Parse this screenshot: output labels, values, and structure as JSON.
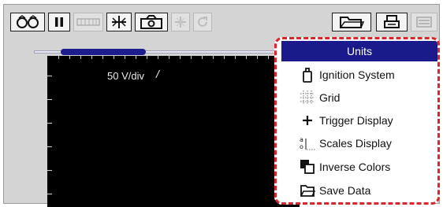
{
  "toolbar": {
    "left_buttons": [
      {
        "icon": "link-icon",
        "state": "enabled"
      },
      {
        "icon": "pause-icon",
        "state": "enabled"
      },
      {
        "icon": "memory-bar-icon",
        "state": "disabled"
      },
      {
        "icon": "cursor-cross-icon",
        "state": "enabled"
      },
      {
        "icon": "camera-icon",
        "state": "enabled"
      },
      {
        "icon": "zoom-icon",
        "state": "disabled"
      },
      {
        "icon": "refresh-icon",
        "state": "disabled"
      }
    ],
    "right_buttons": [
      {
        "icon": "open-folder-icon",
        "state": "enabled"
      },
      {
        "icon": "print-icon",
        "state": "enabled"
      },
      {
        "icon": "menu-icon",
        "state": "selected"
      }
    ]
  },
  "scope": {
    "scale_label": "50 V/div",
    "trigger_symbol": "/"
  },
  "menu": {
    "items": [
      {
        "label": "Units",
        "icon": "none",
        "selected": true
      },
      {
        "label": "Ignition System",
        "icon": "ignition-coil-icon",
        "selected": false
      },
      {
        "label": "Grid",
        "icon": "grid-icon",
        "selected": false
      },
      {
        "label": "Trigger Display",
        "icon": "plus-icon",
        "selected": false
      },
      {
        "label": "Scales Display",
        "icon": "scales-icon",
        "selected": false
      },
      {
        "label": "Inverse Colors",
        "icon": "inverse-colors-icon",
        "selected": false
      },
      {
        "label": "Save Data",
        "icon": "save-data-icon",
        "selected": false
      }
    ]
  },
  "colors": {
    "highlight": "#1a1a8c",
    "callout_border": "#d8262b",
    "scope_background": "#000000"
  }
}
